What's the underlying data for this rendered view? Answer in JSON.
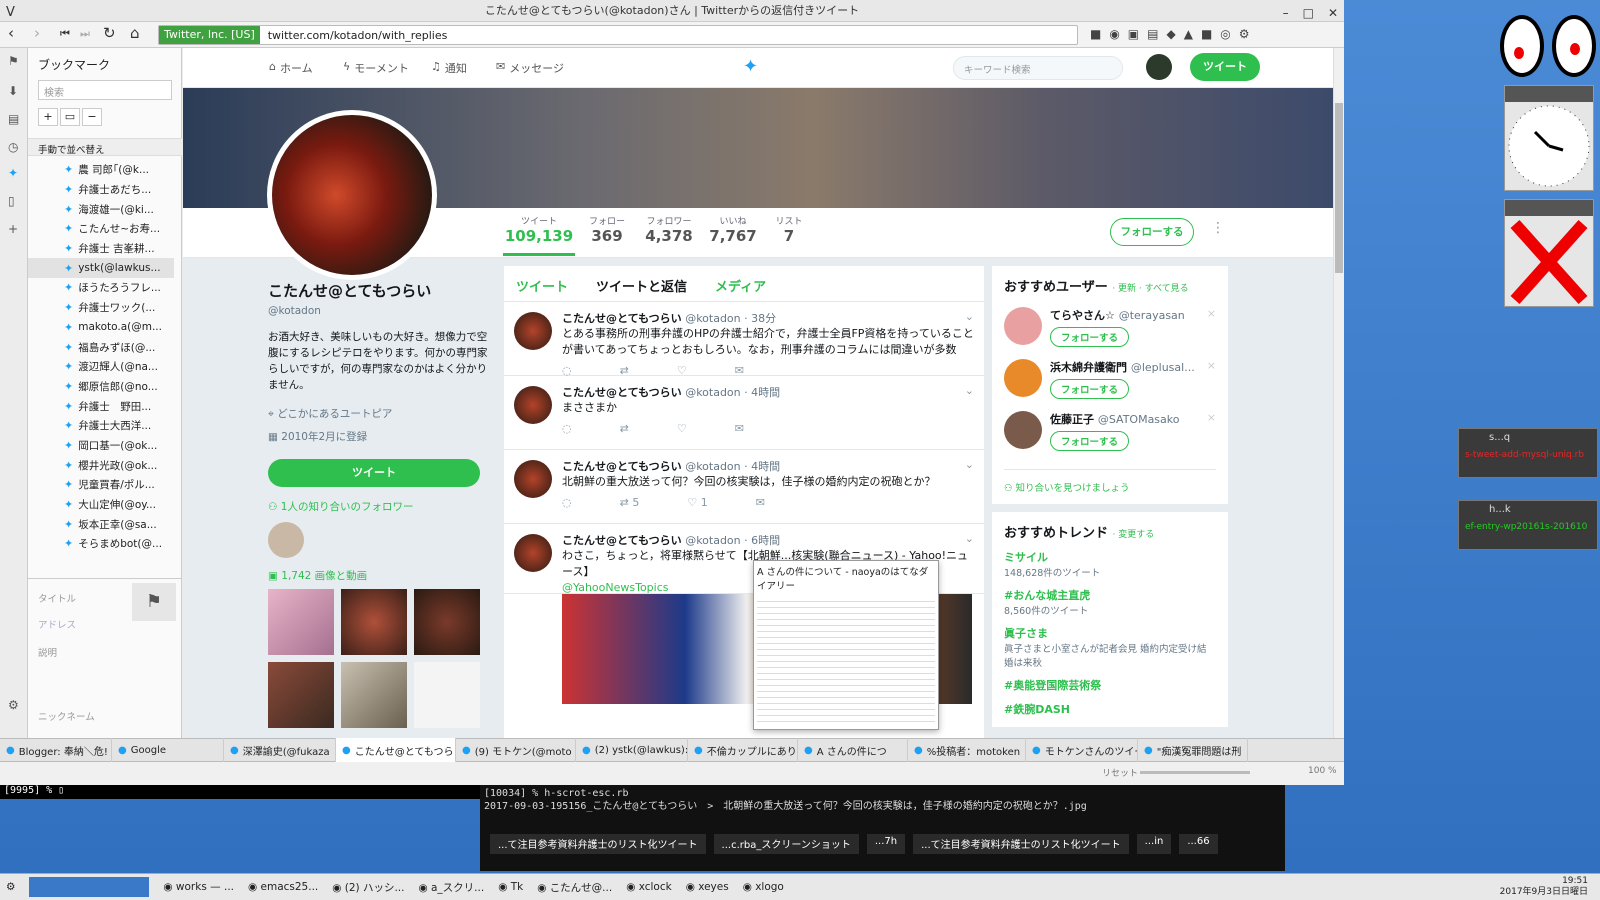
{
  "window": {
    "title": "こたんせ@とてもつらい(@kotadon)さん | Twitterからの返信付きツイート"
  },
  "navbar": {
    "secure_label": "Twitter, Inc. [US]",
    "url": "twitter.com/kotadon/with_replies"
  },
  "bookmarks": {
    "title": "ブックマーク",
    "search_placeholder": "検索",
    "sort_label": "手動で並べ替え",
    "items": [
      "農 司郎｢(@k...",
      "弁護士あだち...",
      "海渡雄一(@ki...",
      "こたんせ~お寿...",
      "弁護士 吉峯耕...",
      "ystk(@lawkus...",
      "ほうたろうフレ...",
      "弁護士ワック(...",
      "makoto.a(@m...",
      "福島みずほ(@...",
      "渡辺輝人(@na...",
      "郷原信郎(@no...",
      "弁護士　野田...",
      "弁護士大西洋...",
      "岡口基一(@ok...",
      "櫻井光政(@ok...",
      "児童買春/ポル...",
      "大山定伸(@oy...",
      "坂本正幸(@sa...",
      "そらまめbot(@..."
    ],
    "selected_index": 5,
    "props": {
      "title_label": "タイトル",
      "address_label": "アドレス",
      "desc_label": "説明",
      "nick_label": "ニックネーム"
    }
  },
  "twitter_nav": {
    "home": "ホーム",
    "moments": "モーメント",
    "notifications": "通知",
    "messages": "メッセージ",
    "search_placeholder": "キーワード検索",
    "tweet_button": "ツイート"
  },
  "stats": [
    {
      "label": "ツイート",
      "value": "109,139"
    },
    {
      "label": "フォロー",
      "value": "369"
    },
    {
      "label": "フォロワー",
      "value": "4,378"
    },
    {
      "label": "いいね",
      "value": "7,767"
    },
    {
      "label": "リスト",
      "value": "7"
    }
  ],
  "follow_button": "フォローする",
  "profile": {
    "name": "こたんせ@とてもつらい",
    "handle": "@kotadon",
    "bio": "お酒大好き、美味しいもの大好き。想像力で空腹にするレシピテロをやります。何かの専門家らしいですが，何の専門家なのかはよく分かりません。",
    "location": "どこかにあるユートピア",
    "joined": "2010年2月に登録",
    "tweet_button": "ツイート",
    "followers_you_know": "1人の知り合いのフォロワー",
    "media_count": "1,742 画像と動画"
  },
  "tabs": [
    "ツイート",
    "ツイートと返信",
    "メディア"
  ],
  "tweets": [
    {
      "name": "こたんせ@とてもつらい",
      "meta": "@kotadon · 38分",
      "text": "とある事務所の刑事弁護のHPの弁護士紹介で，弁護士全員FP資格を持っていることが書いてあってちょっとおもしろい。なお，刑事弁護のコラムには間違いが多数",
      "rt": "",
      "likes": ""
    },
    {
      "name": "こたんせ@とてもつらい",
      "meta": "@kotadon · 4時間",
      "text": "まささまか",
      "rt": "",
      "likes": ""
    },
    {
      "name": "こたんせ@とてもつらい",
      "meta": "@kotadon · 4時間",
      "text": "北朝鮮の重大放送って何？今回の核実験は，佳子様の婚約内定の祝砲とか？",
      "rt": "5",
      "likes": "1"
    },
    {
      "name": "こたんせ@とてもつらい",
      "meta": "@kotadon · 6時間",
      "text": "わさこ，ちょっと，将軍様黙らせて【北朝鮮...核実験(聯合ニュース) - Yahoo!ニュース】",
      "link": "@YahooNewsTopics",
      "rt": "",
      "likes": ""
    }
  ],
  "popup": {
    "title": "A さんの件について - naoyaのはてなダイアリー"
  },
  "recommend": {
    "heading": "おすすめユーザー",
    "links": "· 更新 · すべて見る",
    "users": [
      {
        "name": "てらやさん☆",
        "handle": "@terayasan",
        "color": "#e8a0a0"
      },
      {
        "name": "浜木綿弁護衛門",
        "handle": "@leplusal...",
        "color": "#e88a2a"
      },
      {
        "name": "佐藤正子",
        "handle": "@SATOMasako",
        "color": "#7a5a4a"
      }
    ],
    "follow_label": "フォローする",
    "find_friends": "知り合いを見つけましょう"
  },
  "trends": {
    "heading": "おすすめトレンド",
    "change": "· 変更する",
    "items": [
      {
        "title": "ミサイル",
        "sub": "148,628件のツイート"
      },
      {
        "title": "#おんな城主直虎",
        "sub": "8,560件のツイート"
      },
      {
        "title": "眞子さま",
        "sub": "眞子さまと小室さんが記者会見 婚約内定受け結婚は来秋"
      },
      {
        "title": "#奥能登国際芸術祭",
        "sub": ""
      },
      {
        "title": "#鉄腕DASH",
        "sub": ""
      }
    ]
  },
  "browser_tabs": [
    "Blogger: 奉納＼危!",
    "Google",
    "深澤諭史(@fukaza",
    "こたんせ@とてもつら",
    "(9) モトケン(@moto",
    "(2) ystk(@lawkus):",
    "不倫カップルにあり",
    "A さんの件につ",
    "%投稿者：motoken",
    "モトケンさんのツイー",
    "\"痴漢冤罪問題は刑"
  ],
  "statusbar": {
    "reset": "リセット",
    "zoom": "100 %"
  },
  "terminal1": "[9995]  % ▯",
  "terminal2": [
    "[10034]  % h-scrot-esc.rb",
    "2017-09-03-195156_こたんせ@とてもつらい　>　北朝鮮の重大放送って何？今回の核実験は，佳子様の婚約内定の祝砲とか？.jpg"
  ],
  "terminal_tabs": [
    "...て注目参考資料弁護士のリスト化ツイート",
    "...c.rba_スクリーンショット",
    "...7h",
    "...て注目参考資料弁護士のリスト化ツイート",
    "...in",
    "...66"
  ],
  "mini_windows": [
    {
      "title": "s...q",
      "text": "s-tweet-add-mysql-uniq.rb"
    },
    {
      "title": "h...k",
      "text": "ef-entry-wp20161s-201610"
    }
  ],
  "taskbar": [
    "works — ...",
    "emacs25...",
    "(2) ハッシ...",
    "a_スクリ...",
    "Tk",
    "こたんせ@...",
    "xclock",
    "xeyes",
    "xlogo"
  ],
  "clock": {
    "time": "19:51",
    "date": "2017年9月3日日曜日"
  }
}
